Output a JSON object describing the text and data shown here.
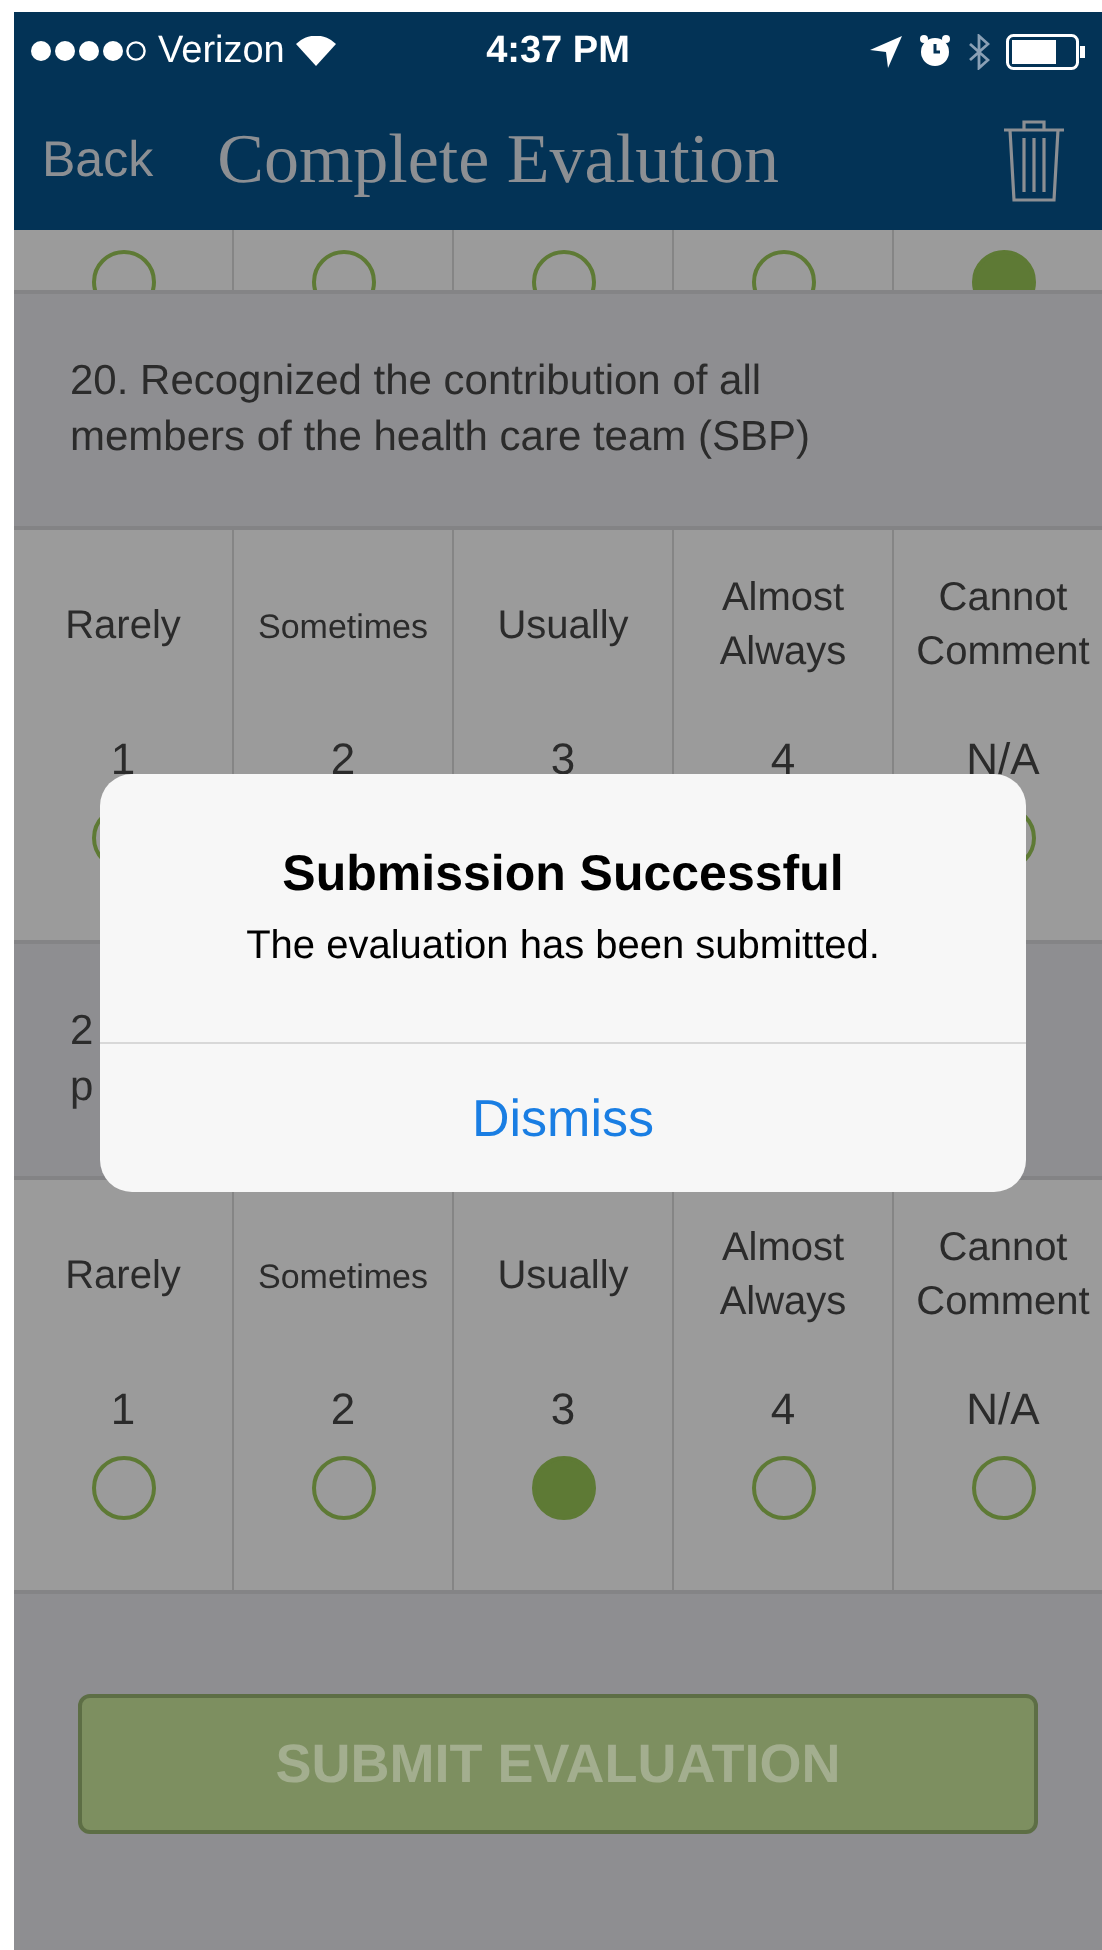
{
  "status_bar": {
    "carrier": "Verizon",
    "time": "4:37 PM"
  },
  "nav": {
    "back": "Back",
    "title": "Complete Evalution"
  },
  "partial_row": {
    "options": [
      {
        "selected": false
      },
      {
        "selected": false
      },
      {
        "selected": false
      },
      {
        "selected": false
      },
      {
        "selected": true
      }
    ]
  },
  "questions": [
    {
      "lines": [
        "20. Recognized the contribution of all",
        "members of the health care team (SBP)"
      ],
      "options": [
        {
          "label": "Rarely",
          "value": "1",
          "selected": false
        },
        {
          "label": "Sometimes",
          "value": "2"
        },
        {
          "label": "Usually",
          "value": "3"
        },
        {
          "label": "Almost Always",
          "value": "4"
        },
        {
          "label": "Cannot Comment",
          "value": "N/A",
          "selected": false
        }
      ]
    },
    {
      "lines": [
        "2",
        "p"
      ],
      "options": [
        {
          "label": "Rarely",
          "value": "1",
          "selected": false
        },
        {
          "label": "Sometimes",
          "value": "2",
          "selected": false
        },
        {
          "label": "Usually",
          "value": "3",
          "selected": true
        },
        {
          "label": "Almost Always",
          "value": "4",
          "selected": false
        },
        {
          "label": "Cannot Comment",
          "value": "N/A",
          "selected": false
        }
      ]
    }
  ],
  "submit": {
    "label": "SUBMIT EVALUATION",
    "disabled": true
  },
  "dialog": {
    "title": "Submission Successful",
    "message": "The evaluation has been submitted.",
    "button": "Dismiss"
  }
}
